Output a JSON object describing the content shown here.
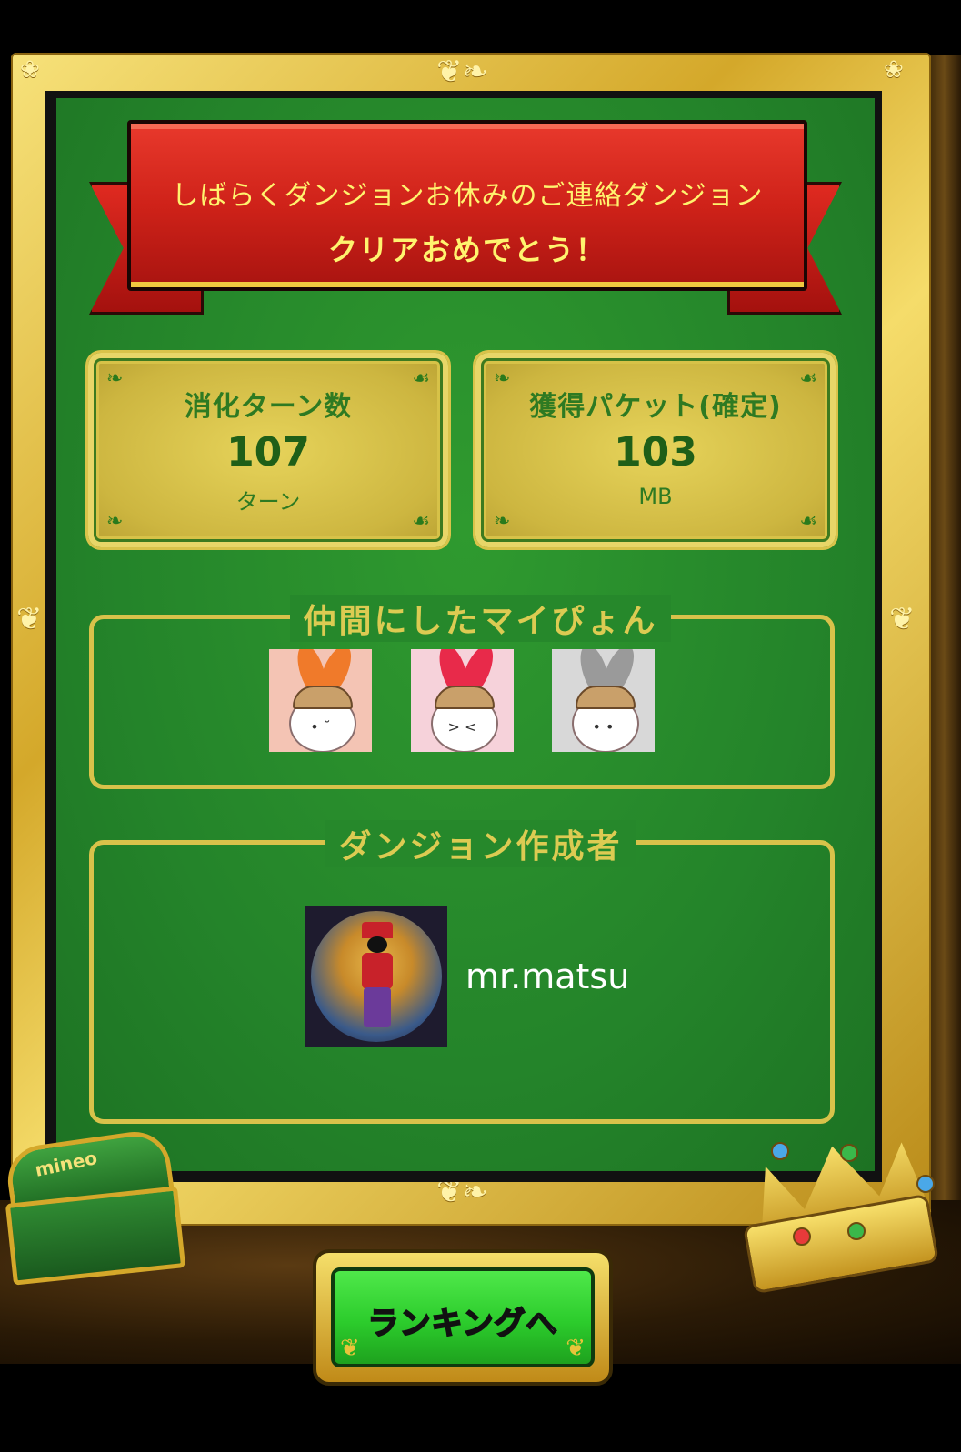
{
  "ribbon": {
    "line1": "しばらくダンジョンお休みのご連絡ダンジョン",
    "line2": "クリアおめでとう！"
  },
  "stats": {
    "turns": {
      "title": "消化ターン数",
      "value": "107",
      "unit": "ターン"
    },
    "packets": {
      "title": "獲得パケット(確定)",
      "value": "103",
      "unit": "MB"
    }
  },
  "buddies": {
    "title": "仲間にしたマイぴょん",
    "items": [
      {
        "name": "orange-bunny",
        "ear_color": "#f07a2a",
        "bg": "#f4c4b4"
      },
      {
        "name": "red-bunny",
        "ear_color": "#e82a4a",
        "bg": "#f6d2da"
      },
      {
        "name": "gray-bunny",
        "ear_color": "#9a9a9a",
        "bg": "#d8d8d8"
      }
    ]
  },
  "creator": {
    "title": "ダンジョン作成者",
    "name": "mr.matsu"
  },
  "chest": {
    "label": "mineo"
  },
  "button": {
    "label": "ランキングへ"
  },
  "colors": {
    "board_green": "#26882b",
    "gold": "#d8c24a",
    "ribbon_red": "#cf2219",
    "ribbon_text": "#fff36e",
    "button_green": "#2ccc2c"
  }
}
